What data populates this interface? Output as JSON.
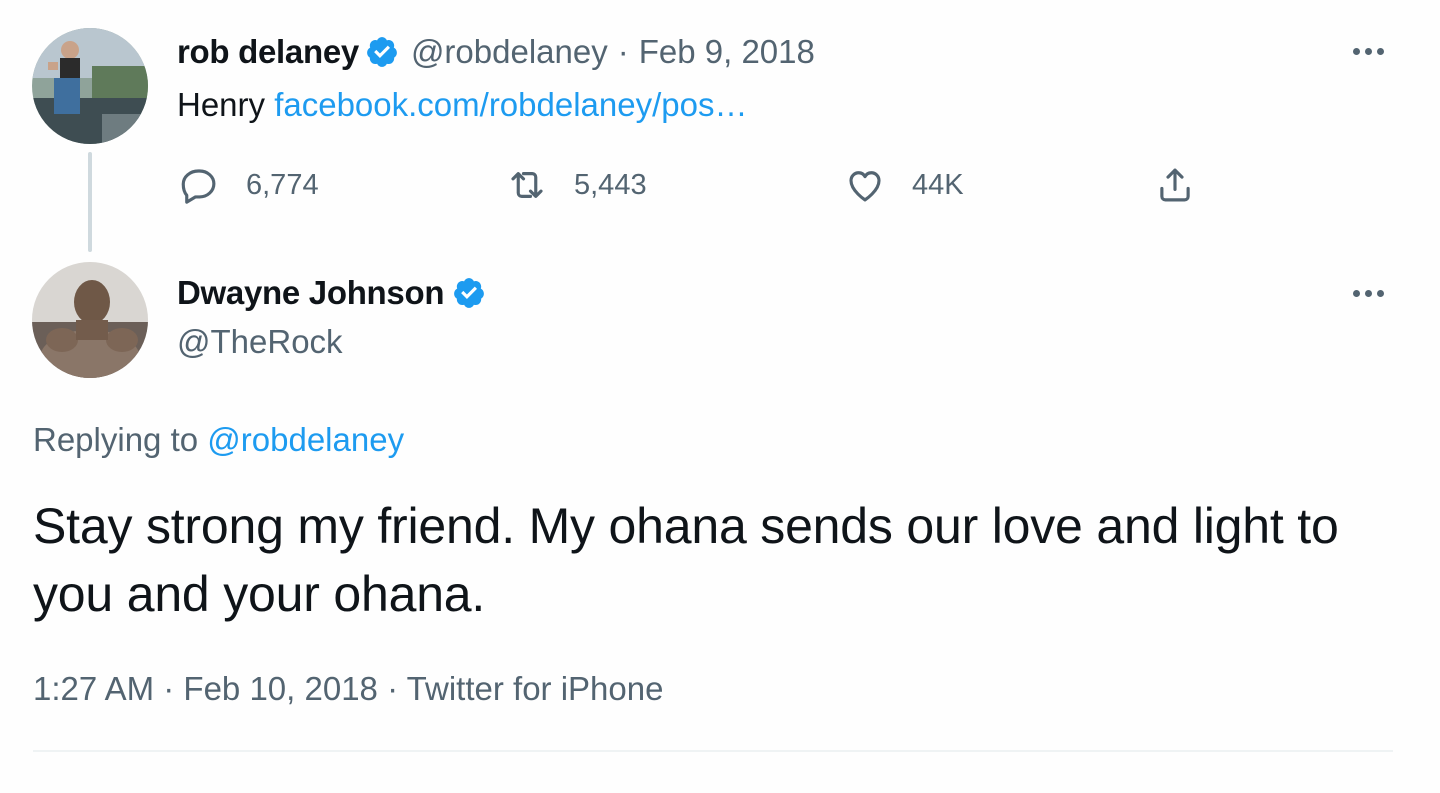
{
  "original_tweet": {
    "author_name": "rob delaney",
    "handle": "@robdelaney",
    "separator": "·",
    "date": "Feb 9, 2018",
    "text": "Henry",
    "link_text": "facebook.com/robdelaney/pos…",
    "avatar_icon": "user-avatar-photo",
    "actions": {
      "replies": "6,774",
      "retweets": "5,443",
      "likes": "44K"
    }
  },
  "reply_tweet": {
    "author_name": "Dwayne Johnson",
    "handle": "@TheRock",
    "avatar_icon": "user-avatar-photo",
    "replying_to_label": "Replying to",
    "replying_to_handle": "@robdelaney",
    "text": "Stay strong my friend. My ohana sends our love and light to you and your ohana.",
    "time": "1:27 AM",
    "sep1": "·",
    "date": "Feb 10, 2018",
    "sep2": "·",
    "source": "Twitter for iPhone"
  },
  "colors": {
    "accent": "#1d9bf0",
    "muted": "#536471",
    "text": "#0f1419"
  }
}
